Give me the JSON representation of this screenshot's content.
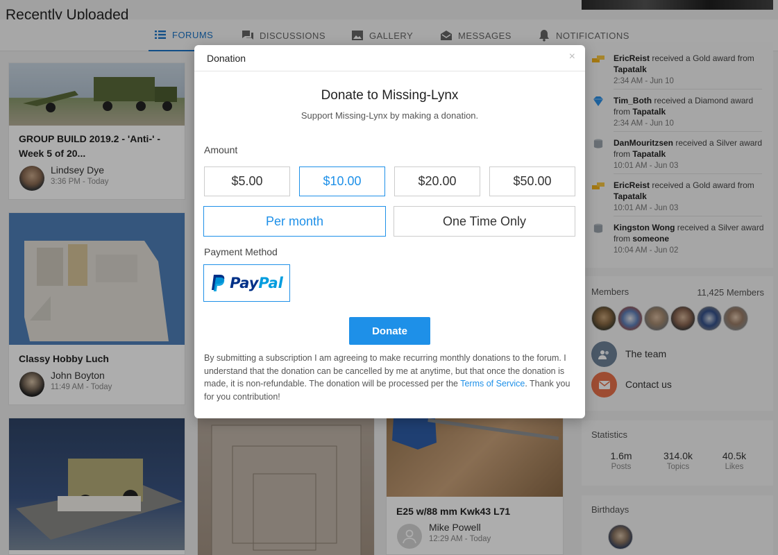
{
  "page": {
    "title": "Recently Uploaded"
  },
  "nav": [
    {
      "label": "FORUMS",
      "icon": "list-icon",
      "active": true
    },
    {
      "label": "DISCUSSIONS",
      "icon": "chat-icon",
      "active": false
    },
    {
      "label": "GALLERY",
      "icon": "image-icon",
      "active": false
    },
    {
      "label": "MESSAGES",
      "icon": "envelope-icon",
      "active": false
    },
    {
      "label": "NOTIFICATIONS",
      "icon": "bell-icon",
      "active": false
    }
  ],
  "cards": [
    {
      "title": "GROUP BUILD 2019.2 - 'Anti-' - Week 5 of 20...",
      "author": "Lindsey Dye",
      "time": "3:36 PM - Today"
    },
    {
      "title": "Classy Hobby Luch",
      "author": "John Boyton",
      "time": "11:49 AM - Today"
    },
    {
      "title": "E25 w/88 mm Kwk43 L71",
      "author": "Mike Powell",
      "time": "12:29 AM - Today"
    }
  ],
  "activity": [
    {
      "user": "EricReist",
      "text": " received a Gold award from ",
      "from": "Tapatalk",
      "time": "2:34 AM - Jun 10",
      "award": "gold"
    },
    {
      "user": "Tim_Both",
      "text": " received a Diamond award from ",
      "from": "Tapatalk",
      "time": "2:34 AM - Jun 10",
      "award": "diamond"
    },
    {
      "user": "DanMouritzsen",
      "text": " received a Silver award from ",
      "from": "Tapatalk",
      "time": "10:01 AM - Jun 03",
      "award": "silver"
    },
    {
      "user": "EricReist",
      "text": " received a Gold award from ",
      "from": "Tapatalk",
      "time": "10:01 AM - Jun 03",
      "award": "gold"
    },
    {
      "user": "Kingston Wong",
      "text": " received a Silver award from ",
      "from": "someone",
      "time": "10:04 AM - Jun 02",
      "award": "silver"
    }
  ],
  "members": {
    "label": "Members",
    "count": "11,425  Members",
    "team_label": "The team",
    "contact_label": "Contact us"
  },
  "statistics": {
    "label": "Statistics",
    "items": [
      {
        "value": "1.6m",
        "label": "Posts"
      },
      {
        "value": "314.0k",
        "label": "Topics"
      },
      {
        "value": "40.5k",
        "label": "Likes"
      }
    ]
  },
  "birthdays": {
    "label": "Birthdays"
  },
  "modal": {
    "header": "Donation",
    "close": "×",
    "heading": "Donate to Missing-Lynx",
    "subheading": "Support Missing-Lynx by making a donation.",
    "amount_label": "Amount",
    "amounts": [
      "$5.00",
      "$10.00",
      "$20.00",
      "$50.00"
    ],
    "selected_amount": "$10.00",
    "frequencies": [
      "Per month",
      "One Time Only"
    ],
    "selected_frequency": "Per month",
    "payment_label": "Payment Method",
    "paypal_pay": "Pay",
    "paypal_pal": "Pal",
    "donate_button": "Donate",
    "disclaimer_main": "By submitting a subscription I am agreeing to make recurring monthly donations to the forum. I understand that the donation can be cancelled by me at anytime, but that once the donation is made, it is non-refundable. The donation will be processed per the ",
    "terms_link": "Terms of Service",
    "disclaimer_end": ". Thank you for you contribution!"
  },
  "colors": {
    "accent": "#1e90e8",
    "nav_active": "#1a73c7",
    "gold": "#f2b21b",
    "diamond": "#2b8fe6",
    "silver": "#9aa3ab",
    "contact": "#e8704a",
    "team": "#6d8299"
  }
}
